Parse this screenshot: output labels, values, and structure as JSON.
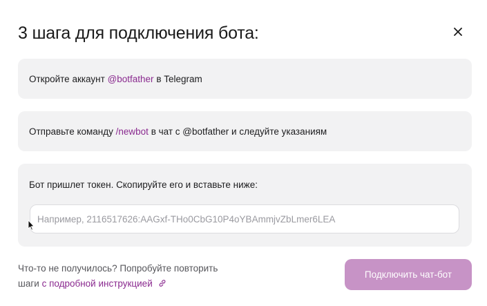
{
  "modal": {
    "title": "3 шага для подключения бота:",
    "close_label": "×"
  },
  "steps": [
    {
      "text_before": "Откройте аккаунт ",
      "link": "@botfather",
      "text_after": " в Telegram"
    },
    {
      "text_before": "Отправьте команду ",
      "link": "/newbot",
      "text_after": " в чат с @botfather и следуйте указаниям"
    },
    {
      "text": "Бот пришлет токен. Скопируйте его и вставьте ниже:",
      "input": {
        "value": "",
        "placeholder": "Например, 2116517626:AAGxf-THo0CbG10P4oYBAmmjvZbLmer6LEA"
      }
    }
  ],
  "help": {
    "line1": "Что-то не получилось? Попробуйте повторить",
    "line2_before": "шаги ",
    "link": "с подробной инструкцией",
    "link_icon": "link-icon"
  },
  "connect_button": {
    "label": "Подключить чат-бот",
    "background": "#c793c6"
  },
  "colors": {
    "accent": "#8a2a8f",
    "step_background": "#f2f2f3"
  }
}
